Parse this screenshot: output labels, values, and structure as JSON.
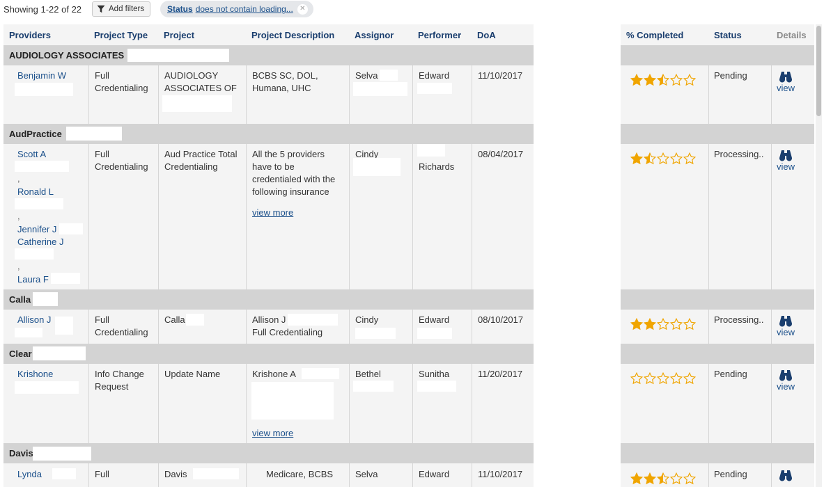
{
  "toolbar": {
    "showing": "Showing 1-22 of 22",
    "add_filters": "Add filters",
    "filter_chip": {
      "key": "Status",
      "text": "does not contain loading..."
    }
  },
  "columns": {
    "providers": "Providers",
    "project_type": "Project Type",
    "project": "Project",
    "project_description": "Project Description",
    "assignor": "Assignor",
    "performer": "Performer",
    "doa": "DoA",
    "completed": "% Completed",
    "status": "Status",
    "details": "Details"
  },
  "view_label": "view",
  "view_more_label": "view more",
  "groups": [
    {
      "name": "AUDIOLOGY ASSOCIATES",
      "row": {
        "providers": [
          "Benjamin W"
        ],
        "project_type": "Full Credentialing",
        "project": "AUDIOLOGY ASSOCIATES OF",
        "description": "BCBS SC, DOL, Humana, UHC",
        "assignor": "Selva",
        "performer": "Edward",
        "doa": "11/10/2017",
        "rating": 2.5,
        "status": "Pending"
      }
    },
    {
      "name": "AudPractice",
      "row": {
        "providers": [
          "Scott A",
          "Ronald L",
          "Jennifer J",
          "Catherine J",
          "Laura F"
        ],
        "project_type": "Full Credentialing",
        "project": "Aud Practice Total Credentialing",
        "description": "All the 5 providers have to be credentialed with the following insurance",
        "assignor": "Cindy",
        "performer": "Richards",
        "doa": "08/04/2017",
        "rating": 1.5,
        "status": "Processing.."
      }
    },
    {
      "name": "Calla",
      "row": {
        "providers": [
          "Allison J"
        ],
        "project_type": "Full Credentialing",
        "project": "Calla",
        "description_line1": "Allison J",
        "description_line2": "Full Credentialing",
        "assignor": "Cindy",
        "performer": "Edward",
        "doa": "08/10/2017",
        "rating": 2,
        "status": "Processing.."
      }
    },
    {
      "name": "Clear",
      "row": {
        "providers": [
          "Krishone"
        ],
        "project_type": "Info Change Request",
        "project": "Update Name",
        "description": "Krishone A",
        "assignor": "Bethel",
        "performer": "Sunitha",
        "doa": "11/20/2017",
        "rating": 0,
        "status": "Pending"
      }
    },
    {
      "name": "Davis",
      "row": {
        "providers": [
          "Lynda"
        ],
        "project_type": "Full",
        "project": "Davis",
        "description": "Medicare, BCBS",
        "assignor": "Selva",
        "performer": "Edward",
        "doa": "11/10/2017",
        "rating": 2.5,
        "status": "Pending"
      }
    }
  ],
  "colors": {
    "header_text": "#1a3e6e",
    "link": "#1a4f8a",
    "group_bg": "#d3d3d3",
    "panel_bg": "#f4f4f4",
    "star": "#f0a500"
  },
  "icons": {
    "filter": "funnel-icon",
    "close": "close-icon",
    "rating": "star-icon",
    "view": "binoculars-icon"
  }
}
